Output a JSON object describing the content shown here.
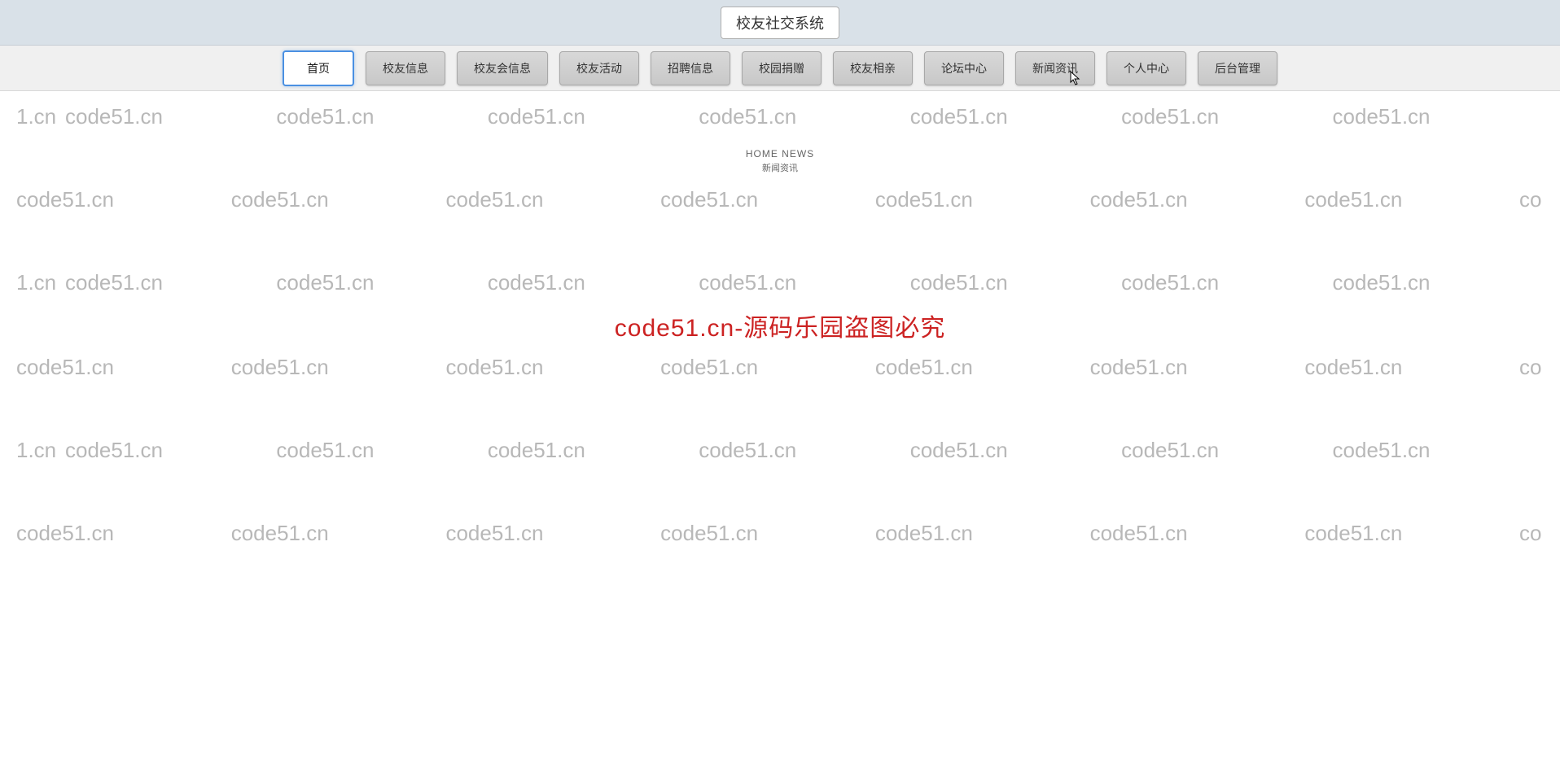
{
  "header": {
    "title": "校友社交系统"
  },
  "nav": {
    "items": [
      {
        "label": "首页",
        "active": true
      },
      {
        "label": "校友信息",
        "active": false
      },
      {
        "label": "校友会信息",
        "active": false
      },
      {
        "label": "校友活动",
        "active": false
      },
      {
        "label": "招聘信息",
        "active": false
      },
      {
        "label": "校园捐赠",
        "active": false
      },
      {
        "label": "校友相亲",
        "active": false
      },
      {
        "label": "论坛中心",
        "active": false
      },
      {
        "label": "新闻资讯",
        "active": false
      },
      {
        "label": "个人中心",
        "active": false
      },
      {
        "label": "后台管理",
        "active": false
      }
    ]
  },
  "section": {
    "title_en": "HOME NEWS",
    "title_cn": "新闻资讯"
  },
  "watermark": {
    "text": "code51.cn",
    "partial_left": "1.cn",
    "partial_right": "co",
    "center_notice": "code51.cn-源码乐园盗图必究"
  }
}
